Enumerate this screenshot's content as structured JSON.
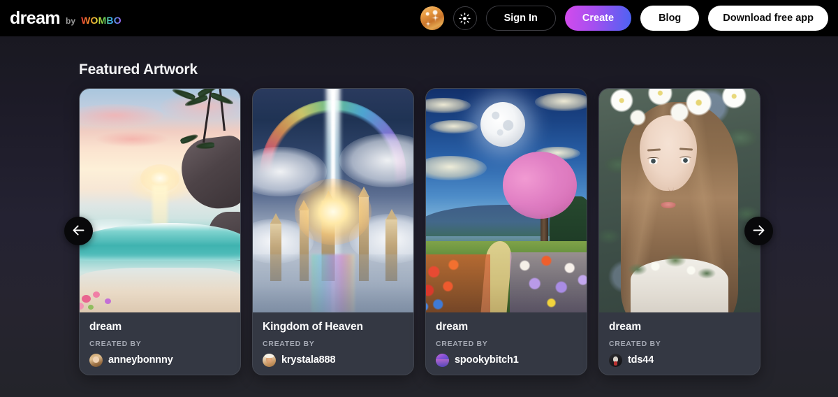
{
  "header": {
    "logo": {
      "name": "dream",
      "by": "by",
      "brand": "WOMBO"
    },
    "avatar_icon": "user-avatar-sparkle-icon",
    "theme_toggle_icon": "sun-brightness-icon",
    "sign_in_label": "Sign In",
    "create_label": "Create",
    "blog_label": "Blog",
    "download_label": "Download free app",
    "colors": {
      "create_gradient_start": "#d44bec",
      "create_gradient_end": "#4b63f2",
      "header_bg": "#000000"
    }
  },
  "main": {
    "section_title": "Featured Artwork",
    "created_by_label": "CREATED BY",
    "prev_arrow_icon": "arrow-left-icon",
    "next_arrow_icon": "arrow-right-icon",
    "cards": [
      {
        "title": "dream",
        "author": "anneybonnny",
        "artwork": "tropical-beach-sunset-with-palm-trees-and-turquoise-wave"
      },
      {
        "title": "Kingdom of Heaven",
        "author": "krystala888",
        "artwork": "rainbow-celestial-castle-with-light-beam"
      },
      {
        "title": "dream",
        "author": "spookybitch1",
        "artwork": "moonlit-flower-field-with-pink-blossom-tree"
      },
      {
        "title": "dream",
        "author": "tds44",
        "artwork": "portrait-of-woman-with-white-flower-crown"
      }
    ]
  },
  "theme": {
    "page_bg_top": "#17171d",
    "page_bg_bottom": "#23242a",
    "card_bg": "#343843",
    "text_primary": "#ffffff",
    "text_muted": "#a4a8b3"
  }
}
